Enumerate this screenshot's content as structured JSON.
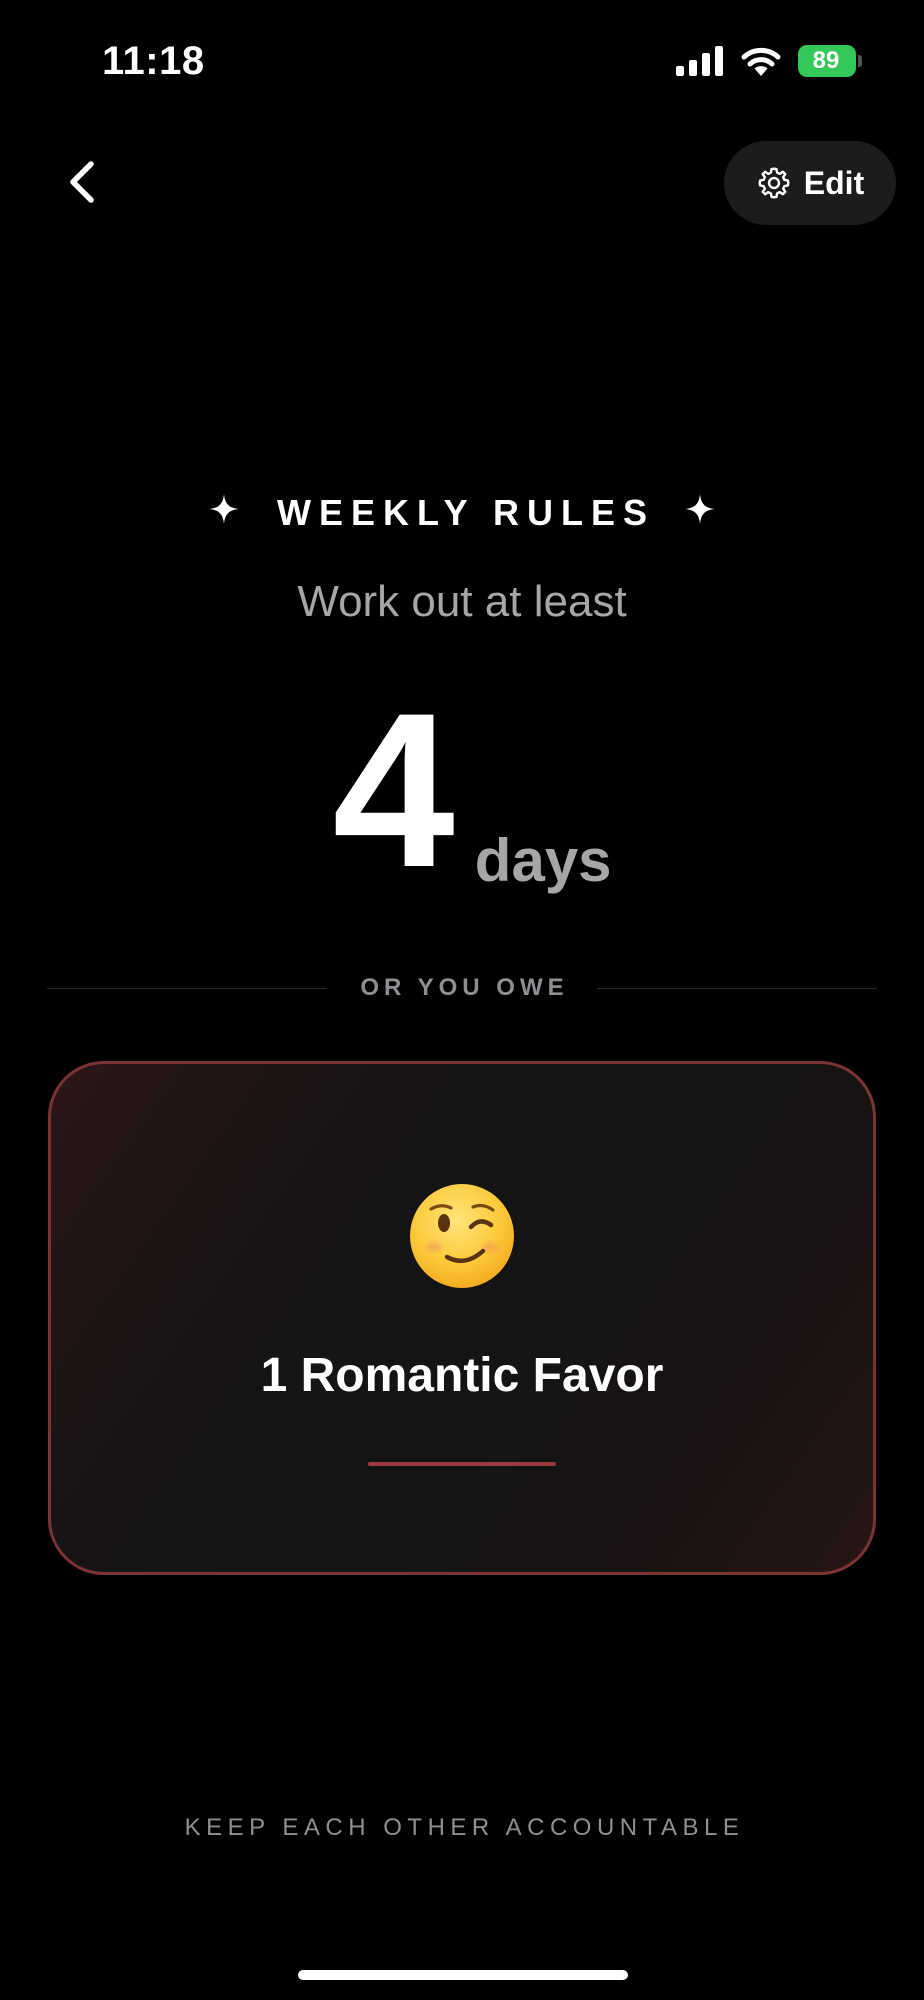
{
  "status_bar": {
    "time": "11:18",
    "battery_level": "89",
    "battery_color": "#34c759",
    "icons": [
      "signal-icon",
      "wifi-icon",
      "battery-charging-icon"
    ]
  },
  "nav": {
    "back_icon": "chevron-left-icon",
    "edit_icon": "gear-icon",
    "edit_label": "Edit"
  },
  "rules": {
    "title": "WEEKLY RULES",
    "title_icon": "sparkle-icon",
    "subtitle": "Work out at least",
    "goal_number": "4",
    "goal_unit": "days"
  },
  "penalty": {
    "divider_label": "OR YOU OWE",
    "emoji": "winking-face",
    "text": "1 Romantic Favor",
    "accent_color": "#9b3a3a"
  },
  "footer": {
    "tagline": "KEEP EACH OTHER ACCOUNTABLE"
  }
}
